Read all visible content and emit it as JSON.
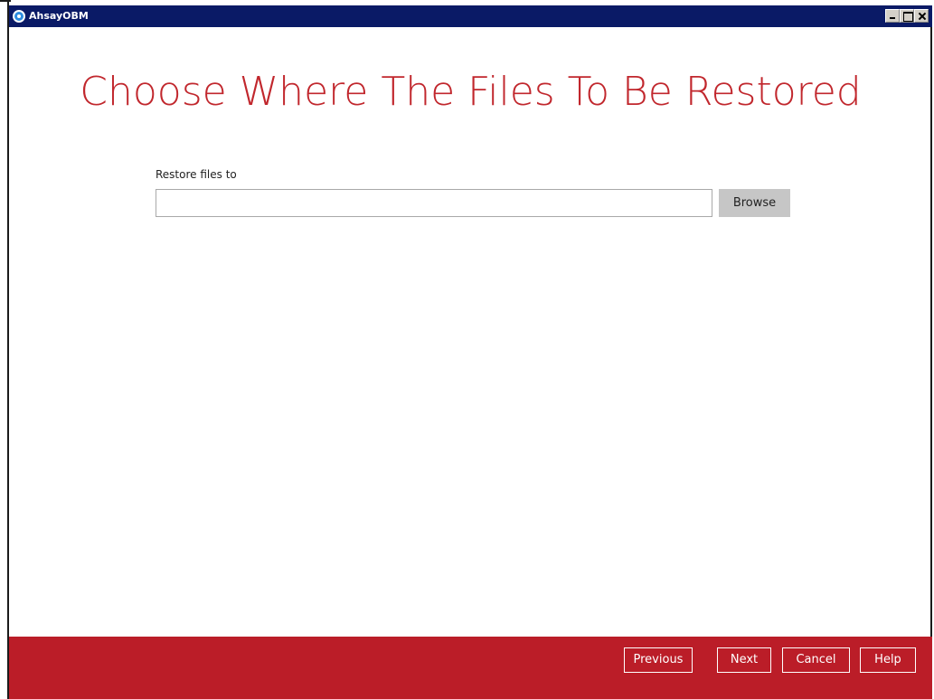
{
  "window": {
    "title": "AhsayOBM",
    "app_icon": "ahsay-logo-icon",
    "controls": {
      "minimize_icon": "minimize-icon",
      "maximize_icon": "maximize-icon",
      "close_icon": "close-icon"
    }
  },
  "main": {
    "heading": "Choose Where The Files To Be Restored",
    "restore_label": "Restore files to",
    "path_input": {
      "value": "",
      "placeholder": ""
    },
    "browse_label": "Browse"
  },
  "footer": {
    "previous_label": "Previous",
    "next_label": "Next",
    "cancel_label": "Cancel",
    "help_label": "Help"
  },
  "colors": {
    "accent": "#c1272d",
    "footer_bg": "#bb1d28",
    "titlebar_bg": "#0a1a66",
    "browse_bg": "#c6c6c6"
  }
}
